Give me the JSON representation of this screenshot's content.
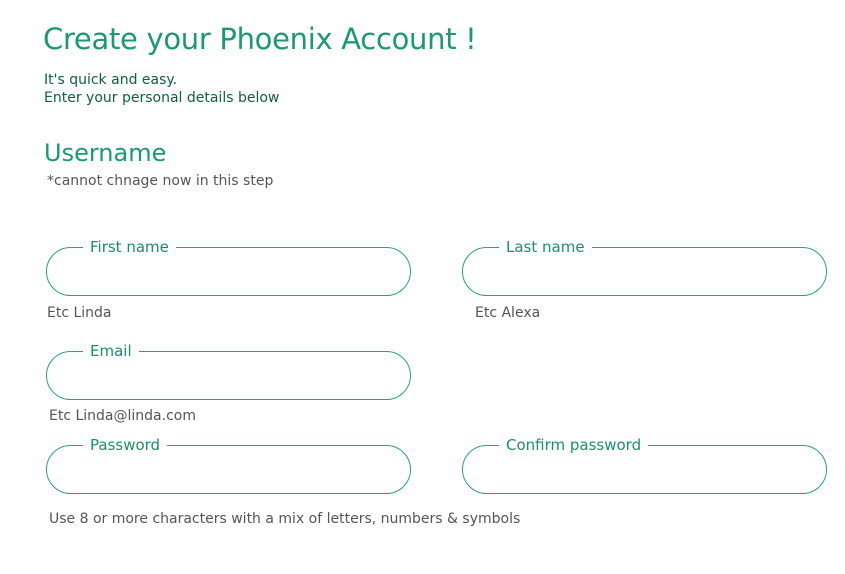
{
  "header": {
    "title": "Create your Phoenix Account !",
    "subtitle_line1": "It's quick and easy.",
    "subtitle_line2": "Enter your personal details below"
  },
  "section": {
    "heading": "Username",
    "note": "*cannot chnage now in this step"
  },
  "fields": {
    "first_name": {
      "label": "First name",
      "value": "",
      "hint": "Etc Linda"
    },
    "last_name": {
      "label": "Last name",
      "value": "",
      "hint": "Etc Alexa"
    },
    "email": {
      "label": "Email",
      "value": "",
      "hint": "Etc Linda@linda.com"
    },
    "password": {
      "label": "Password",
      "value": ""
    },
    "confirm_password": {
      "label": "Confirm password",
      "value": ""
    }
  },
  "password_hint": "Use 8 or more characters with a mix of letters, numbers & symbols",
  "colors": {
    "accent": "#1a9a72",
    "border": "#2aa27c",
    "dark_text": "#0f5e48",
    "hint_text": "#555555"
  }
}
